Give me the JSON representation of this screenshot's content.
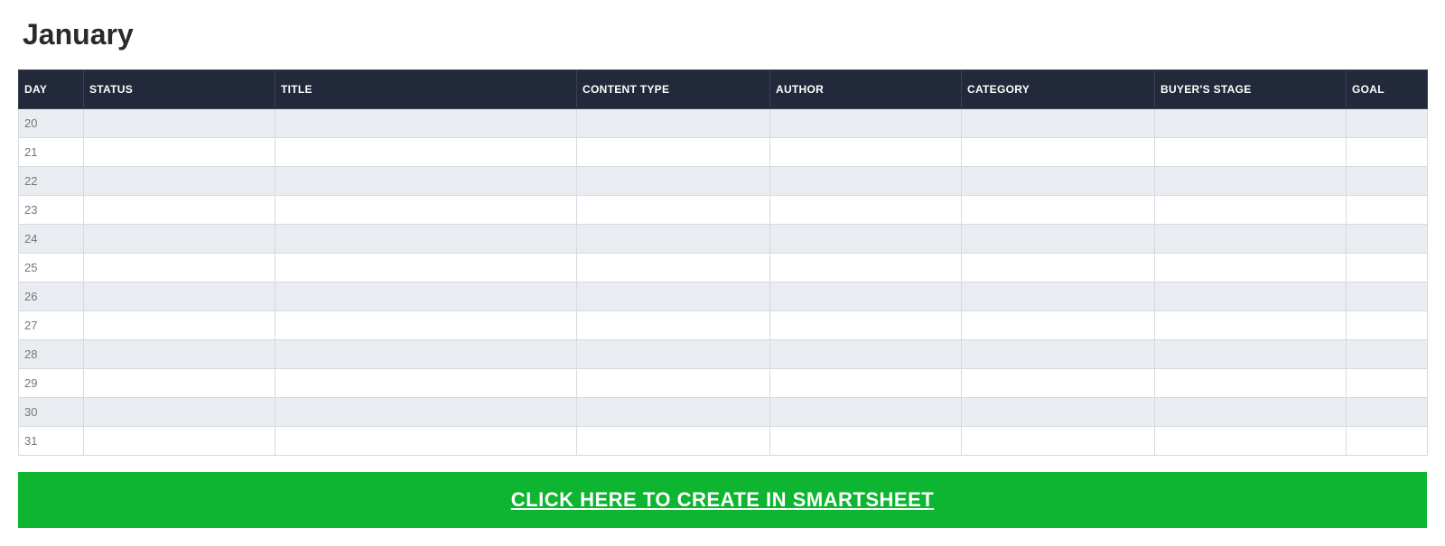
{
  "title": "January",
  "columns": [
    "DAY",
    "STATUS",
    "TITLE",
    "CONTENT TYPE",
    "AUTHOR",
    "CATEGORY",
    "BUYER'S STAGE",
    "GOAL"
  ],
  "rows": [
    {
      "day": "20",
      "status": "",
      "title": "",
      "content_type": "",
      "author": "",
      "category": "",
      "buyers_stage": "",
      "goal": ""
    },
    {
      "day": "21",
      "status": "",
      "title": "",
      "content_type": "",
      "author": "",
      "category": "",
      "buyers_stage": "",
      "goal": ""
    },
    {
      "day": "22",
      "status": "",
      "title": "",
      "content_type": "",
      "author": "",
      "category": "",
      "buyers_stage": "",
      "goal": ""
    },
    {
      "day": "23",
      "status": "",
      "title": "",
      "content_type": "",
      "author": "",
      "category": "",
      "buyers_stage": "",
      "goal": ""
    },
    {
      "day": "24",
      "status": "",
      "title": "",
      "content_type": "",
      "author": "",
      "category": "",
      "buyers_stage": "",
      "goal": ""
    },
    {
      "day": "25",
      "status": "",
      "title": "",
      "content_type": "",
      "author": "",
      "category": "",
      "buyers_stage": "",
      "goal": ""
    },
    {
      "day": "26",
      "status": "",
      "title": "",
      "content_type": "",
      "author": "",
      "category": "",
      "buyers_stage": "",
      "goal": ""
    },
    {
      "day": "27",
      "status": "",
      "title": "",
      "content_type": "",
      "author": "",
      "category": "",
      "buyers_stage": "",
      "goal": ""
    },
    {
      "day": "28",
      "status": "",
      "title": "",
      "content_type": "",
      "author": "",
      "category": "",
      "buyers_stage": "",
      "goal": ""
    },
    {
      "day": "29",
      "status": "",
      "title": "",
      "content_type": "",
      "author": "",
      "category": "",
      "buyers_stage": "",
      "goal": ""
    },
    {
      "day": "30",
      "status": "",
      "title": "",
      "content_type": "",
      "author": "",
      "category": "",
      "buyers_stage": "",
      "goal": ""
    },
    {
      "day": "31",
      "status": "",
      "title": "",
      "content_type": "",
      "author": "",
      "category": "",
      "buyers_stage": "",
      "goal": ""
    }
  ],
  "cta_label": "CLICK HERE TO CREATE IN SMARTSHEET"
}
